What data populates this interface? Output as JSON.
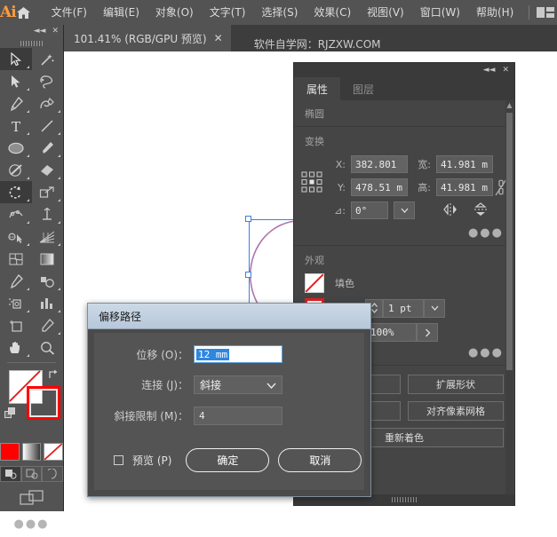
{
  "app": {
    "logo": "Ai",
    "home_icon": "home-icon",
    "workspace_icon": "workspace-switcher-icon"
  },
  "menubar": {
    "items": [
      {
        "label": "文件(F)"
      },
      {
        "label": "编辑(E)"
      },
      {
        "label": "对象(O)"
      },
      {
        "label": "文字(T)"
      },
      {
        "label": "选择(S)"
      },
      {
        "label": "效果(C)"
      },
      {
        "label": "视图(V)"
      },
      {
        "label": "窗口(W)"
      },
      {
        "label": "帮助(H)"
      }
    ]
  },
  "tabbar": {
    "document_tab": "101.41% (RGB/GPU 预览)",
    "close_glyph": "✕",
    "note": "软件自学网：RJZXW.COM"
  },
  "toolbar": {
    "collapse_glyph": "◄◄",
    "close_glyph": "✕",
    "tools": [
      {
        "name": "selection-tool",
        "selected": true
      },
      {
        "name": "magic-wand-tool",
        "selected": false
      },
      {
        "name": "direct-selection-tool",
        "selected": false
      },
      {
        "name": "lasso-tool",
        "selected": false
      },
      {
        "name": "pen-tool",
        "selected": false
      },
      {
        "name": "curvature-tool",
        "selected": false
      },
      {
        "name": "type-tool",
        "selected": false
      },
      {
        "name": "line-segment-tool",
        "selected": false
      },
      {
        "name": "ellipse-tool",
        "selected": false
      },
      {
        "name": "paintbrush-tool",
        "selected": false
      },
      {
        "name": "shaper-tool",
        "selected": false
      },
      {
        "name": "eraser-tool",
        "selected": false
      },
      {
        "name": "rotate-tool",
        "selected": true
      },
      {
        "name": "scale-tool",
        "selected": false
      },
      {
        "name": "width-tool",
        "selected": false
      },
      {
        "name": "free-transform-tool",
        "selected": false
      },
      {
        "name": "shape-builder-tool",
        "selected": false
      },
      {
        "name": "perspective-grid-tool",
        "selected": false
      },
      {
        "name": "mesh-tool",
        "selected": false
      },
      {
        "name": "gradient-tool",
        "selected": false
      },
      {
        "name": "eyedropper-tool",
        "selected": false
      },
      {
        "name": "blend-tool",
        "selected": false
      },
      {
        "name": "symbol-sprayer-tool",
        "selected": false
      },
      {
        "name": "column-graph-tool",
        "selected": false
      },
      {
        "name": "artboard-tool",
        "selected": false
      },
      {
        "name": "slice-tool",
        "selected": false
      },
      {
        "name": "hand-tool",
        "selected": false
      },
      {
        "name": "zoom-tool",
        "selected": false
      }
    ],
    "fill_color": "#ffffff",
    "fill_is_none": true,
    "stroke_color": "#ff0000",
    "swap_icon": "swap-fill-stroke-icon",
    "default_icon": "default-fill-stroke-icon",
    "color_modes": [
      "color-swatch",
      "gradient-swatch",
      "none-swatch"
    ],
    "draw_modes": [
      "draw-normal",
      "draw-behind",
      "draw-inside"
    ],
    "screen_mode_icon": "change-screen-mode-icon",
    "more_glyph": "●●●"
  },
  "canvas": {
    "shape": "ellipse",
    "stroke_color": "#8d6fc4",
    "selection_color": "#3d7fe0"
  },
  "properties": {
    "collapse_glyph": "◄◄",
    "close_glyph": "✕",
    "tabs": [
      {
        "label": "属性",
        "active": true
      },
      {
        "label": "图层",
        "active": false
      }
    ],
    "object_type": "椭圆",
    "transform": {
      "section_label": "变换",
      "reference_point_icon": "reference-point-selector",
      "x_label": "X:",
      "x_value": "382.801",
      "y_label": "Y:",
      "y_value": "478.51 m",
      "w_label": "宽:",
      "w_value": "41.981 m",
      "h_label": "高:",
      "h_value": "41.981 m",
      "link_icon": "constrain-proportions-icon",
      "angle_label": "⊿:",
      "angle_value": "0°",
      "flip_h_icon": "flip-horizontal-icon",
      "flip_v_icon": "flip-vertical-icon",
      "more_glyph": "●●●"
    },
    "appearance": {
      "section_label": "外观",
      "fill_label": "填色",
      "stroke_weight": "1 pt",
      "opacity": "100%",
      "more_glyph": "●●●"
    },
    "actions": {
      "expand_shape": "扩展形状",
      "align_pixel_grid": "对齐像素网格",
      "recolor": "重新着色"
    }
  },
  "dialog": {
    "title": "偏移路径",
    "offset_label": "位移 (O)：",
    "offset_value": "12 mm",
    "join_label": "连接 (J)：",
    "join_value": "斜接",
    "join_chevron": "⌄",
    "miter_label": "斜接限制 (M)：",
    "miter_value": "4",
    "preview_label": "预览 (P)",
    "preview_checked": false,
    "ok_label": "确定",
    "cancel_label": "取消"
  }
}
